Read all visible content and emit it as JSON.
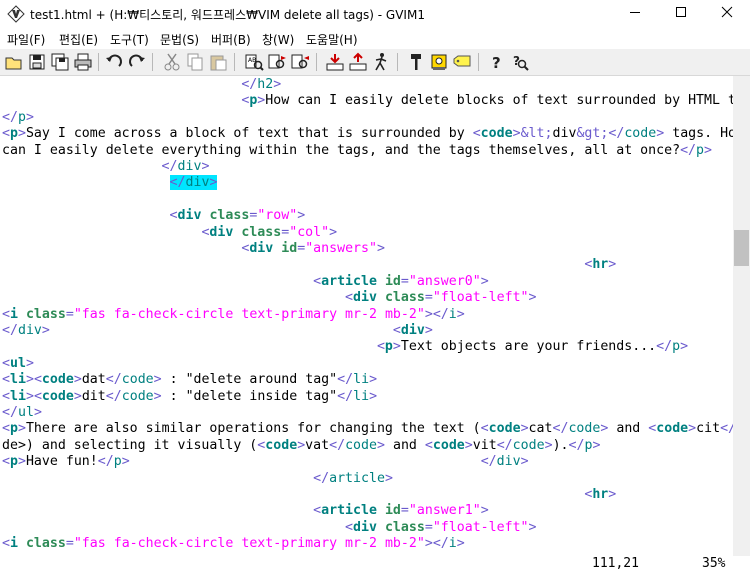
{
  "window": {
    "title": "test1.html + (H:₩티스토리, 워드프레스₩VIM delete all tags) - GVIM1",
    "minimize_glyph": "—",
    "maximize_glyph": "☐",
    "close_glyph": "✕"
  },
  "menu": [
    {
      "label": "파일(F)"
    },
    {
      "label": "편집(E)"
    },
    {
      "label": "도구(T)"
    },
    {
      "label": "문법(S)"
    },
    {
      "label": "버퍼(B)"
    },
    {
      "label": "창(W)"
    },
    {
      "label": "도움말(H)"
    }
  ],
  "toolbar_icons": [
    "open-icon",
    "save-icon",
    "save-all-icon",
    "print-icon",
    "undo-icon",
    "redo-icon",
    "cut-icon",
    "copy-icon",
    "paste-icon",
    "find-replace-icon",
    "find-next-icon",
    "find-prev-icon",
    "load-session-icon",
    "save-session-icon",
    "run-script-icon",
    "make-icon",
    "run-ctags-icon",
    "tag-jump-icon",
    "help-icon",
    "find-help-icon"
  ],
  "editor": {
    "lines": [
      "                              </h2>",
      "                              <p>How can I easily delete blocks of text surrounded by HTML tags?",
      "</p>",
      "<p>Say I come across a block of text that is surrounded by <code>&lt;div&gt;</code> tags. How",
      "can I easily delete everything within the tags, and the tags themselves, all at once?</p>",
      "                    </div>",
      "                     </div>",
      "",
      "                     <div class=\"row\">",
      "                         <div class=\"col\">",
      "                              <div id=\"answers\">",
      "                                                                         <hr>",
      "                                       <article id=\"answer0\">",
      "                                           <div class=\"float-left\">",
      "<i class=\"fas fa-check-circle text-primary mr-2 mb-2\"></i>",
      "</div>                                           <div>",
      "                                               <p>Text objects are your friends...</p>",
      "<ul>",
      "<li><code>dat</code> : \"delete around tag\"</li>",
      "<li><code>dit</code> : \"delete inside tag\"</li>",
      "</ul>",
      "<p>There are also similar operations for changing the text (<code>cat</code> and <code>cit</co",
      "de>) and selecting it visually (<code>vat</code> and <code>vit</code>).</p>",
      "<p>Have fun!</p>                                            </div>",
      "                                       </article>",
      "                                                                         <hr>",
      "                                       <article id=\"answer1\">",
      "                                           <div class=\"float-left\">",
      "<i class=\"fas fa-check-circle text-primary mr-2 mb-2\"></i>"
    ],
    "cursor": {
      "line": 6,
      "col": 21
    }
  },
  "status": {
    "ruler": "111,21",
    "percent": "35%"
  }
}
